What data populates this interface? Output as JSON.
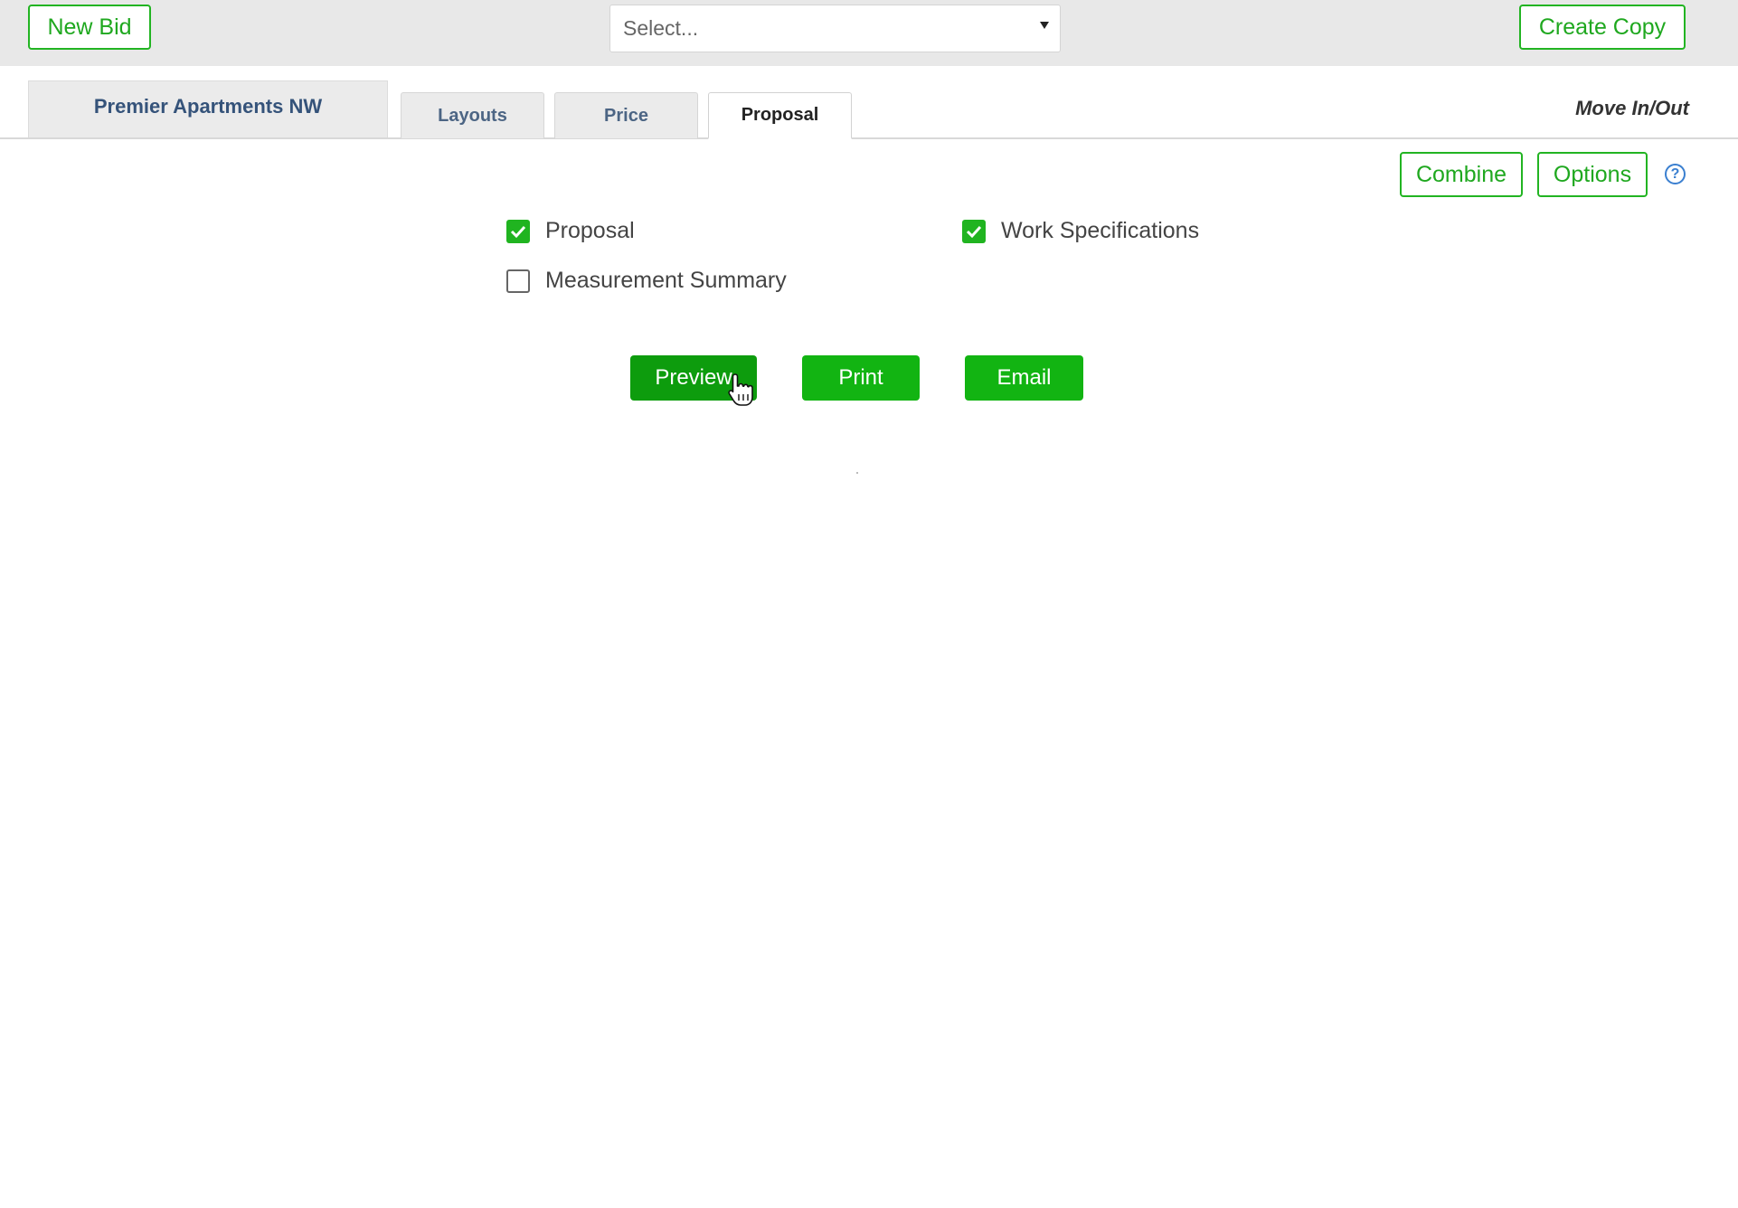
{
  "toolbar": {
    "new_bid_label": "New Bid",
    "select_placeholder": "Select...",
    "create_copy_label": "Create Copy"
  },
  "tabs": {
    "project_name": "Premier Apartments NW",
    "items": [
      {
        "label": "Layouts"
      },
      {
        "label": "Price"
      },
      {
        "label": "Proposal",
        "active": true
      }
    ],
    "move_link": "Move In/Out"
  },
  "actions": {
    "combine_label": "Combine",
    "options_label": "Options",
    "help_glyph": "?"
  },
  "documents": [
    {
      "label": "Proposal",
      "checked": true
    },
    {
      "label": "Work Specifications",
      "checked": true
    },
    {
      "label": "Measurement Summary",
      "checked": false
    }
  ],
  "buttons": {
    "preview_label": "Preview",
    "print_label": "Print",
    "email_label": "Email"
  },
  "colors": {
    "accent_green": "#12b412",
    "outline_green": "#22b422",
    "tab_text": "#35537a",
    "help_blue": "#3a7fd0"
  }
}
